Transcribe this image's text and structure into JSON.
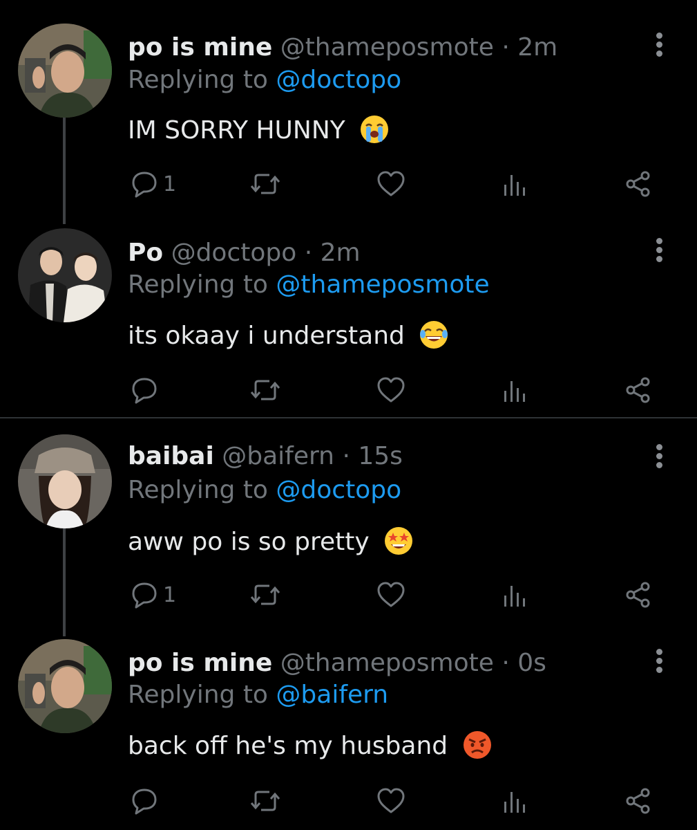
{
  "tweets": [
    {
      "name": "po is mine",
      "handle": "@thameposmote",
      "time": "2m",
      "replying_prefix": "Replying to ",
      "replying_to": "@doctopo",
      "text": "IM SORRY HUNNY",
      "emoji": "loudly-crying-face",
      "reply_count": "1"
    },
    {
      "name": "Po",
      "handle": "@doctopo",
      "time": "2m",
      "replying_prefix": "Replying to ",
      "replying_to": "@thameposmote",
      "text": "its okaay i understand",
      "emoji": "face-with-tears-of-joy",
      "reply_count": ""
    },
    {
      "name": "baibai",
      "handle": "@baifern",
      "time": "15s",
      "replying_prefix": "Replying to ",
      "replying_to": "@doctopo",
      "text": "aww po is so pretty",
      "emoji": "star-struck",
      "reply_count": "1"
    },
    {
      "name": "po is mine",
      "handle": "@thameposmote",
      "time": "0s",
      "replying_prefix": "Replying to ",
      "replying_to": "@baifern",
      "text": "back off he's my husband",
      "emoji": "pouting-face",
      "reply_count": ""
    }
  ],
  "separator": " · ",
  "colors": {
    "background": "#000000",
    "text": "#e7e9ea",
    "muted": "#71767b",
    "link": "#1d9bf0",
    "thread_line": "#3e4144"
  }
}
